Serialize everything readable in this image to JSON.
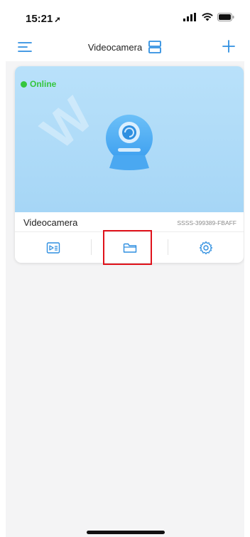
{
  "status_bar": {
    "time": "15:21",
    "location_arrow": "➚"
  },
  "nav": {
    "title": "Videocamera",
    "menu_icon": "menu-icon",
    "layout_icon": "split-view-icon",
    "add_icon": "plus-icon"
  },
  "device_card": {
    "status": "Online",
    "status_color": "#35c63d",
    "name": "Videocamera",
    "device_id": "SSSS-399389-FBAFF",
    "actions": [
      {
        "name": "playback",
        "icon": "video-playback-icon"
      },
      {
        "name": "files",
        "icon": "folder-icon"
      },
      {
        "name": "settings",
        "icon": "gear-icon"
      }
    ]
  },
  "accent_color": "#2f8fe0",
  "highlight_color": "#e0121b"
}
